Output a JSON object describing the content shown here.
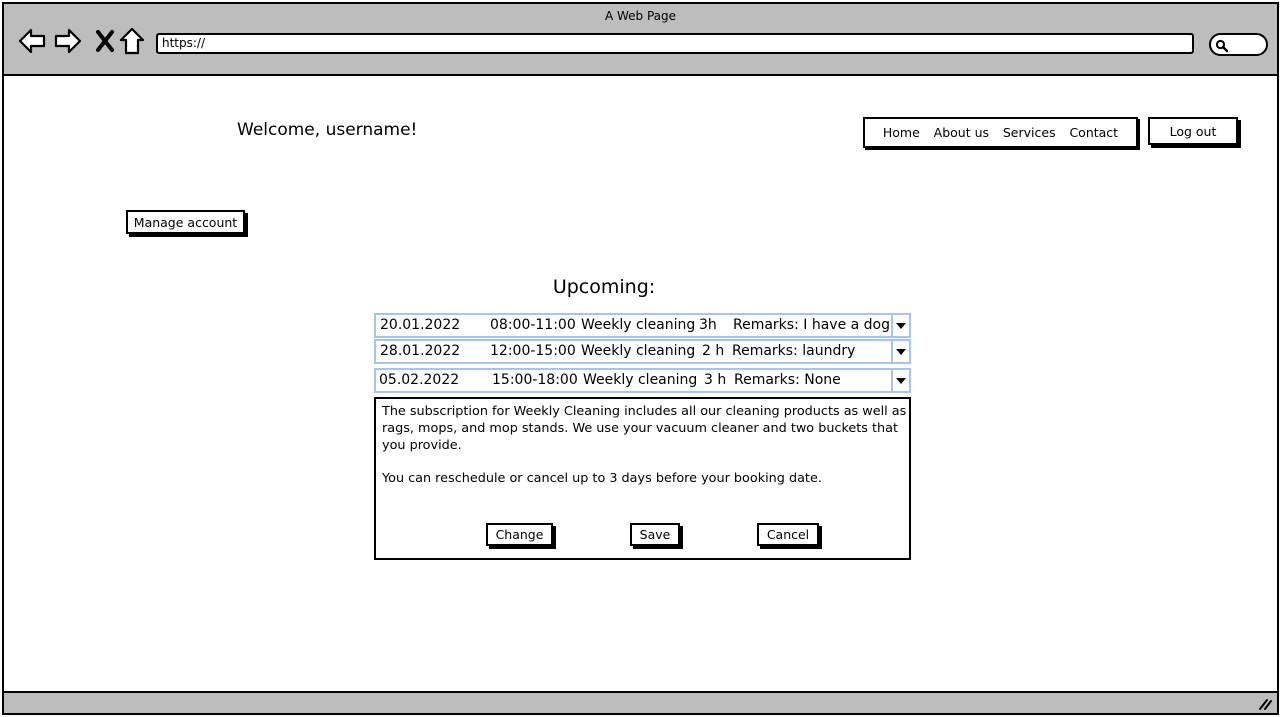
{
  "browser": {
    "title": "A Web Page",
    "url": "https://"
  },
  "header": {
    "welcome": "Welcome, username!",
    "nav": [
      "Home",
      "About us",
      "Services",
      "Contact"
    ],
    "logout_label": "Log out"
  },
  "account": {
    "manage_label": "Manage account"
  },
  "upcoming": {
    "heading": "Upcoming:",
    "bookings": [
      {
        "date": "20.01.2022",
        "time": "08:00-11:00",
        "service": "Weekly cleaning",
        "duration": "3h",
        "remarks": "Remarks: I have a dog."
      },
      {
        "date": "28.01.2022",
        "time": "12:00-15:00",
        "service": "Weekly cleaning",
        "duration": "2 h",
        "remarks": "Remarks: laundry"
      },
      {
        "date": "05.02.2022",
        "time": "15:00-18:00",
        "service": "Weekly cleaning",
        "duration": "3 h",
        "remarks": "Remarks: None"
      }
    ],
    "details": {
      "paragraph1": "The subscription for Weekly Cleaning includes all our cleaning products as well as rags, mops, and mop stands. We use your vacuum cleaner and two buckets that you provide.",
      "paragraph2": "You can reschedule or cancel up to 3 days before your booking date.",
      "change_label": "Change",
      "save_label": "Save",
      "cancel_label": "Cancel"
    }
  }
}
